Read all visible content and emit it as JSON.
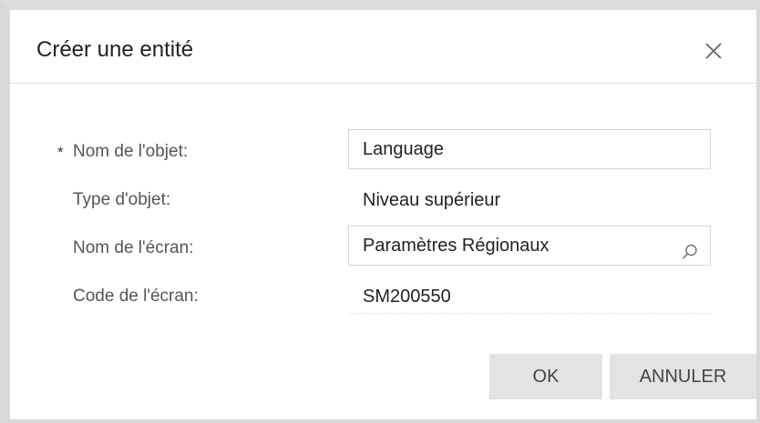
{
  "dialog": {
    "title": "Créer une entité",
    "close_icon": "close-icon"
  },
  "form": {
    "required_marker": "*",
    "object_name": {
      "label": "Nom de l'objet:",
      "value": "Language"
    },
    "object_type": {
      "label": "Type d'objet:",
      "value": "Niveau supérieur"
    },
    "screen_name": {
      "label": "Nom de l'écran:",
      "value": "Paramètres Régionaux",
      "icon": "search-icon"
    },
    "screen_code": {
      "label": "Code de l'écran:",
      "value": "SM200550"
    }
  },
  "buttons": {
    "ok_label": "OK",
    "cancel_label": "ANNULER"
  }
}
